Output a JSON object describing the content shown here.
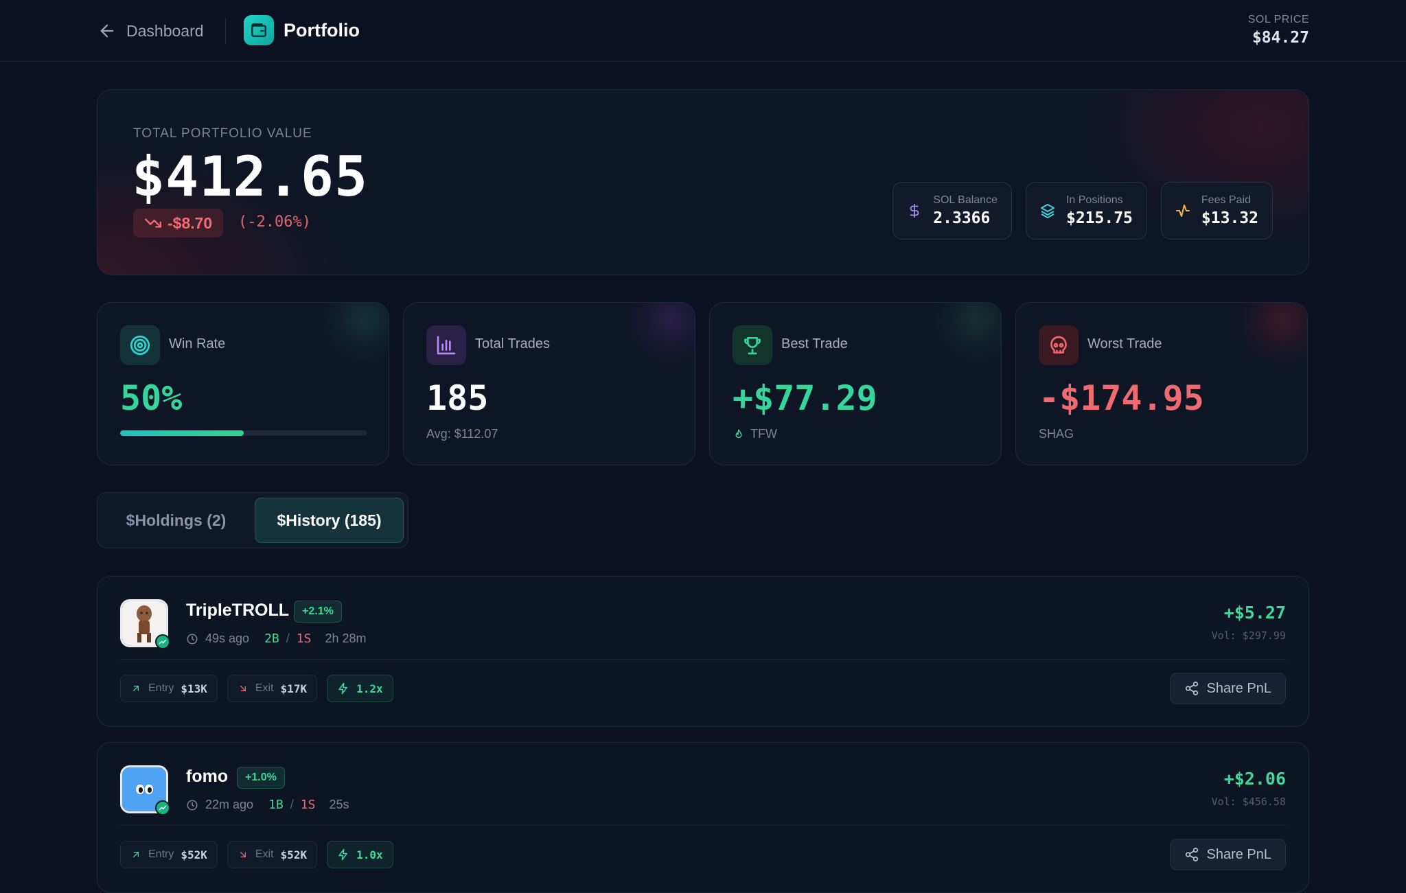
{
  "header": {
    "back_label": "Dashboard",
    "title": "Portfolio",
    "sol_price_label": "SOL PRICE",
    "sol_price_value": "$84.27"
  },
  "portfolio": {
    "label": "TOTAL PORTFOLIO VALUE",
    "value": "$412.65",
    "change": "-$8.70",
    "change_pct": "(-2.06%)",
    "stats": [
      {
        "label": "SOL Balance",
        "value": "2.3366",
        "icon": "dollar-icon"
      },
      {
        "label": "In Positions",
        "value": "$215.75",
        "icon": "layers-icon"
      },
      {
        "label": "Fees Paid",
        "value": "$13.32",
        "icon": "activity-icon"
      }
    ]
  },
  "cards": {
    "win_rate": {
      "title": "Win Rate",
      "value": "50%",
      "progress": 0.5
    },
    "total_trades": {
      "title": "Total Trades",
      "value": "185",
      "sub": "Avg: $112.07"
    },
    "best_trade": {
      "title": "Best Trade",
      "value": "+$77.29",
      "sub": "TFW"
    },
    "worst_trade": {
      "title": "Worst Trade",
      "value": "-$174.95",
      "sub": "SHAG"
    }
  },
  "tabs": {
    "holdings": "$Holdings (2)",
    "history": "$History (185)",
    "active": "history"
  },
  "trades": [
    {
      "name": "TripleTROLL",
      "pct": "+2.1%",
      "time": "49s ago",
      "buys": "2B",
      "sells": "1S",
      "duration": "2h 28m",
      "pnl": "+$5.27",
      "vol": "Vol: $297.99",
      "entry_label": "Entry",
      "entry": "$13K",
      "exit_label": "Exit",
      "exit": "$17K",
      "multiplier": "1.2x",
      "share_label": "Share PnL"
    },
    {
      "name": "fomo",
      "pct": "+1.0%",
      "time": "22m ago",
      "buys": "1B",
      "sells": "1S",
      "duration": "25s",
      "pnl": "+$2.06",
      "vol": "Vol: $456.58",
      "entry_label": "Entry",
      "entry": "$52K",
      "exit_label": "Exit",
      "exit": "$52K",
      "multiplier": "1.0x",
      "share_label": "Share PnL"
    }
  ],
  "colors": {
    "background": "#0b1120",
    "positive": "#3fd89b",
    "negative": "#ea6a70",
    "accent": "#22d3c5"
  }
}
